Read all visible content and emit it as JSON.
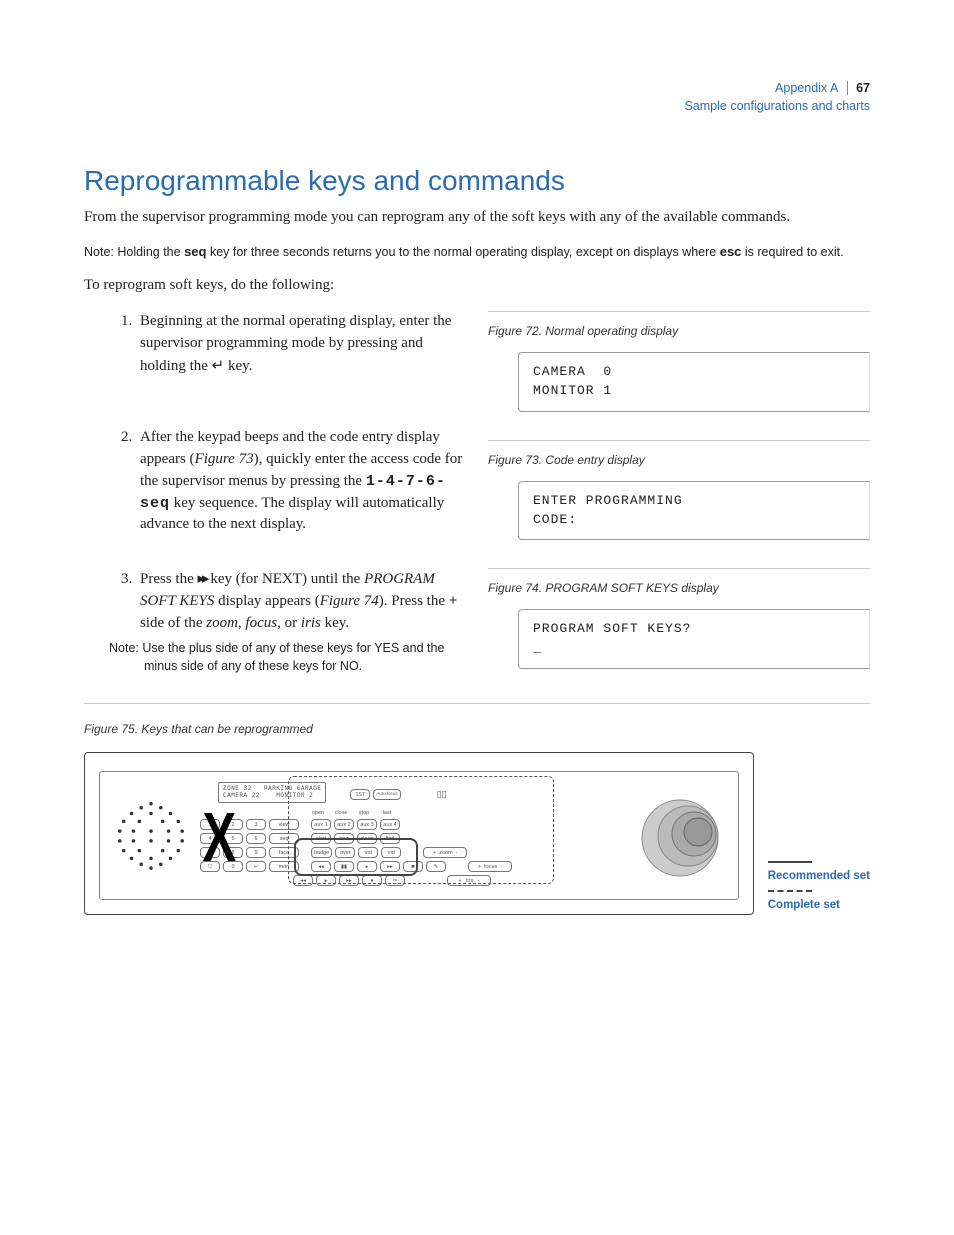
{
  "header": {
    "appendix": "Appendix A",
    "subtitle": "Sample configurations and charts",
    "page_number": "67"
  },
  "title": "Reprogrammable keys and commands",
  "intro": "From the supervisor programming mode you can reprogram any of the soft keys with any of the available commands.",
  "note1_prefix": "Note:  Holding the ",
  "note1_key1": "seq",
  "note1_mid": " key for three seconds returns you to the normal operating display, except on displays where ",
  "note1_key2": "esc",
  "note1_suffix": " is required to exit.",
  "lead_in": "To reprogram soft keys, do the following:",
  "steps": {
    "s1_a": "Beginning at the normal operating display, enter the supervisor programming mode by pressing and holding the ",
    "s1_b": " key.",
    "return_glyph": "↵",
    "s2_a": "After the keypad beeps and the code entry display appears (",
    "s2_ref": "Figure 73",
    "s2_b": "), quickly enter the access code for the supervisor menus by pressing the ",
    "s2_seq": "1-4-7-6-seq",
    "s2_c": " key sequence. The display will automatically advance to the next display.",
    "s3_a": "Press the ",
    "ff_glyph": "▸▸",
    "s3_b": " key (for NEXT) until the ",
    "s3_disp": "PROGRAM SOFT KEYS",
    "s3_c": " display appears (",
    "s3_ref": "Figure 74",
    "s3_d": "). Press the ",
    "s3_plus": "+",
    "s3_e": " side of the ",
    "s3_zoom": "zoom",
    "s3_f": ", ",
    "s3_focus": "focus",
    "s3_g": ", or ",
    "s3_iris": "iris",
    "s3_h": " key."
  },
  "note2": "Note:  Use the plus side of any of these keys for YES and the minus side of any of these keys for NO.",
  "figures": {
    "f72_caption": "Figure 72.  Normal operating display",
    "f72_line1": "CAMERA  0",
    "f72_line2": "MONITOR 1",
    "f73_caption": "Figure 73.  Code entry display",
    "f73_line1": "ENTER PROGRAMMING",
    "f73_line2": "CODE:",
    "f74_caption": "Figure 74.  PROGRAM SOFT KEYS display",
    "f74_line1": "PROGRAM SOFT KEYS?",
    "f74_line2": "_",
    "f75_caption": "Figure 75.  Keys that can be reprogrammed"
  },
  "keypad": {
    "lcd_line1": "ZONE 32   PARKING GARAGE",
    "lcd_line2": "CAMERA 22    MONITOR 2",
    "btn_1st": "1ST",
    "btn_auto_focus": "Auto focus",
    "lbl_open": "open",
    "lbl_close": "close",
    "lbl_stop": "stop",
    "lbl_last": "last",
    "btn_view": "view",
    "btn_aux1": "aux 1",
    "btn_aux2": "aux 2",
    "btn_aux3": "aux 3",
    "btn_aux4": "aux 4",
    "btn_seq": "seq",
    "btn_alert": "alert",
    "btn_tour": "tour",
    "btn_alarm": "alarm",
    "btn_find": "find",
    "btn_face": "face",
    "btn_badge": "badge",
    "btn_over": "over",
    "btn_vid": "vid",
    "btn_vid2": "vid",
    "btn_mon": "mon",
    "btn_zoom": "zoom",
    "btn_focus": "focus",
    "btn_iris": "iris",
    "plus": "+",
    "minus": "-",
    "g_rw": "◂◂",
    "g_pause": "▮▮",
    "g_play": "▸",
    "g_ff": "▸▸",
    "g_stop": "■",
    "g_rec": "●",
    "g_clip": "✎",
    "g_clip2": "✂"
  },
  "legend": {
    "recommended": "Recommended set",
    "complete": "Complete set"
  }
}
